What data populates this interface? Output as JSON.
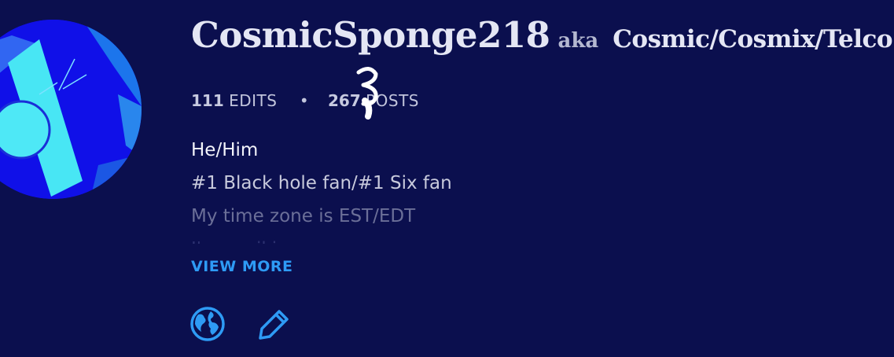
{
  "profile": {
    "username": "CosmicSponge218",
    "aka_label": "aka",
    "alias": "Cosmic/Cosmix/Telco"
  },
  "stats": {
    "edits_count": "111",
    "edits_label": "EDITS",
    "separator": "•",
    "posts_count": "267",
    "posts_label": "POSTS"
  },
  "bio": {
    "lines": [
      "He/Him",
      "#1 Black hole fan/#1 Six fan",
      "My time zone is EST/EDT",
      "I'm a wiki"
    ]
  },
  "actions": {
    "view_more_label": "VIEW MORE"
  },
  "icons": {
    "website": "globe-icon",
    "edit": "pencil-icon"
  },
  "colors": {
    "background": "#0b0f4e",
    "accent": "#2e9bf5",
    "text": "#e4e6f4"
  }
}
